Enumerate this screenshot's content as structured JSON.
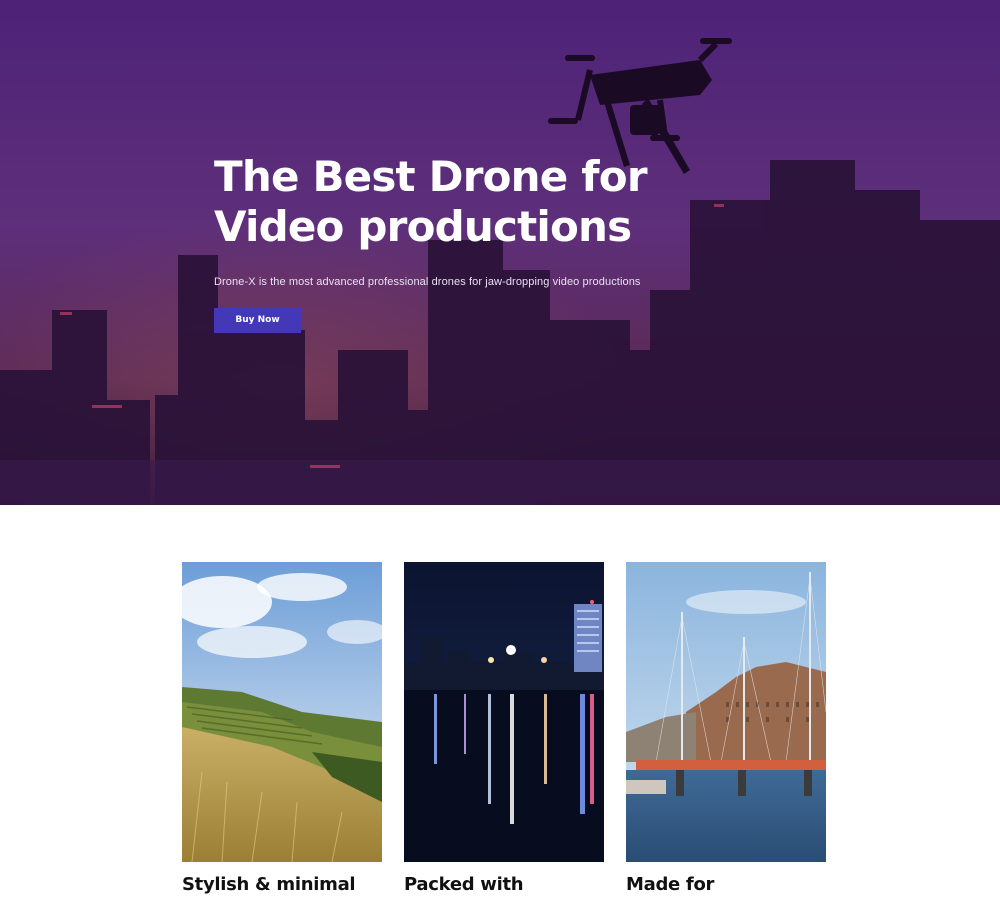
{
  "hero": {
    "title_line1": "The Best Drone for",
    "title_line2": "Video productions",
    "subtitle": "Drone-X is the most advanced professional drones for jaw-dropping video productions",
    "cta_label": "Buy Now",
    "accent_color": "#4338b8"
  },
  "features": [
    {
      "title": "Stylish & minimal",
      "image": "vineyard-hillside-photo"
    },
    {
      "title": "Packed with",
      "image": "night-city-waterfront-photo"
    },
    {
      "title": "Made for",
      "image": "harbor-bridge-photo"
    }
  ]
}
